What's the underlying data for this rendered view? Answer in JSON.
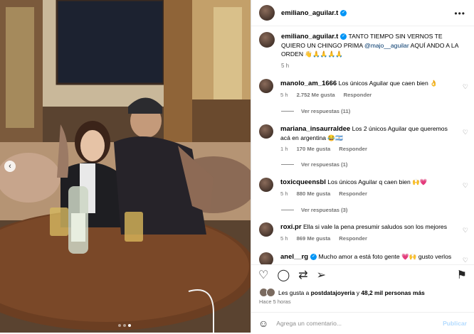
{
  "header": {
    "username": "emiliano_aguilar.t",
    "more_icon": "more-horizontal-icon"
  },
  "caption": {
    "username": "emiliano_aguilar.t",
    "text_before": "TANTO TIEMPO SIN VERNOS TE QUIERO UN CHINGO PRIMA",
    "mention": "@majo__aguilar",
    "text_after": "AQUÍ ANDO A LA ORDEN 👋🙏🙏🙏🙏",
    "time": "5 h"
  },
  "comments": [
    {
      "username": "manolo_am_1666",
      "text": "Los únicos Aguilar que caen bien 👌",
      "time": "5 h",
      "likes": "2.752 Me gusta",
      "reply": "Responder",
      "replies": "Ver respuestas (11)"
    },
    {
      "username": "mariana_insaurraldee",
      "text": "Los 2 únicos Aguilar que queremos acá en argentina 😂🇦🇷",
      "time": "1 h",
      "likes": "170 Me gusta",
      "reply": "Responder",
      "replies": "Ver respuestas (1)"
    },
    {
      "username": "toxicqueensbl",
      "text": "Los únicos Aguilar q caen bien 🙌💗",
      "time": "5 h",
      "likes": "880 Me gusta",
      "reply": "Responder",
      "replies": "Ver respuestas (3)"
    },
    {
      "username": "roxi.pr",
      "text": "Ella si vale la pena presumir saludos son los mejores",
      "time": "5 h",
      "likes": "869 Me gusta",
      "reply": "Responder",
      "replies": ""
    },
    {
      "username": "anel__rg",
      "text": "Mucho amor a está foto gente 💗🙌 gusto verlos",
      "time": "",
      "likes": "",
      "reply": "",
      "replies": ""
    }
  ],
  "likes_line": {
    "prefix": "Les gusta a",
    "user": "postdatajoyeria",
    "middle": "y",
    "count": "48,2 mil personas más"
  },
  "post_time": "Hace 5 horas",
  "add_comment": {
    "placeholder": "Agrega un comentario...",
    "publish": "Publicar"
  },
  "colors": {
    "accent": "#0095f6",
    "link": "#00376b",
    "publish_disabled": "#b3dbff",
    "heart": "#ed4956"
  }
}
